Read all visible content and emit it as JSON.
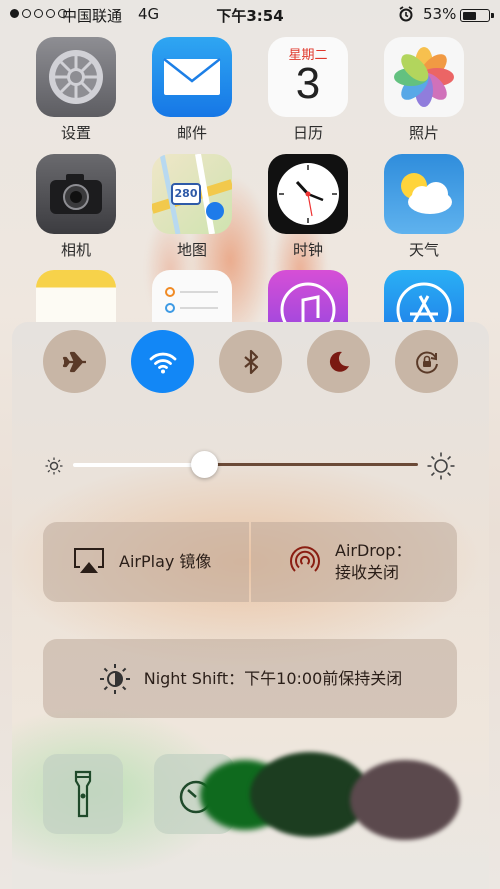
{
  "status_bar": {
    "carrier": "中国联通",
    "network": "4G",
    "time": "下午3:54",
    "battery_percent": "53%",
    "battery_level": 0.53,
    "signal_bars_filled": 1,
    "signal_bars_total": 5
  },
  "home_screen": {
    "apps": [
      {
        "label": "设置",
        "icon": "settings-icon"
      },
      {
        "label": "邮件",
        "icon": "mail-icon"
      },
      {
        "label": "日历",
        "icon": "calendar-icon",
        "weekday": "星期二",
        "day": "3"
      },
      {
        "label": "照片",
        "icon": "photos-icon"
      },
      {
        "label": "相机",
        "icon": "camera-icon"
      },
      {
        "label": "地图",
        "icon": "maps-icon",
        "route_number": "280"
      },
      {
        "label": "时钟",
        "icon": "clock-icon"
      },
      {
        "label": "天气",
        "icon": "weather-icon"
      },
      {
        "icon": "notes-icon"
      },
      {
        "icon": "reminders-icon"
      },
      {
        "icon": "itunes-icon"
      },
      {
        "icon": "app-store-icon"
      }
    ]
  },
  "control_center": {
    "toggles": [
      {
        "name": "airplane-mode",
        "icon": "airplane-icon",
        "active": false
      },
      {
        "name": "wifi",
        "icon": "wifi-icon",
        "active": true
      },
      {
        "name": "bluetooth",
        "icon": "bluetooth-icon",
        "active": false
      },
      {
        "name": "do-not-disturb",
        "icon": "moon-icon",
        "active": false
      },
      {
        "name": "rotation-lock",
        "icon": "rotation-lock-icon",
        "active": false
      }
    ],
    "brightness_level": 0.38,
    "airplay_label": "AirPlay 镜像",
    "airdrop_line1": "AirDrop：",
    "airdrop_line2": "接收关闭",
    "night_shift_label": "Night Shift：下午10:00前保持关闭",
    "tools": [
      {
        "name": "flashlight",
        "icon": "flashlight-icon"
      },
      {
        "name": "timer",
        "icon": "timer-icon"
      }
    ]
  },
  "colors": {
    "accent_blue": "#1287f6",
    "toggle_bg": "#c8b6a6",
    "icon_brown": "#5a3a28"
  }
}
